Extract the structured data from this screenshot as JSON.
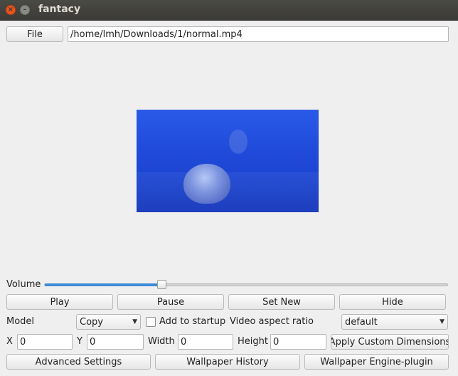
{
  "window": {
    "title": "fantacy",
    "close_glyph": "×",
    "minimize_glyph": "–"
  },
  "file": {
    "button_label": "File",
    "path": "/home/lmh/Downloads/1/normal.mp4"
  },
  "volume": {
    "label": "Volume",
    "level_percent": 29
  },
  "playback": {
    "play_label": "Play",
    "pause_label": "Pause",
    "set_new_label": "Set New",
    "hide_label": "Hide"
  },
  "options": {
    "model_label": "Model",
    "model_value": "Copy",
    "add_to_startup_label": "Add to startup",
    "add_to_startup_checked": false,
    "aspect_label": "Video aspect ratio",
    "aspect_value": "default"
  },
  "dimensions": {
    "x_label": "X",
    "x_value": "0",
    "y_label": "Y",
    "y_value": "0",
    "width_label": "Width",
    "width_value": "0",
    "height_label": "Height",
    "height_value": "0",
    "apply_label": "Apply Custom Dimensions"
  },
  "footer": {
    "advanced_label": "Advanced Settings",
    "history_label": "Wallpaper History",
    "engine_label": "Wallpaper Engine-plugin"
  },
  "icons": {
    "dropdown_arrow": "▼"
  }
}
